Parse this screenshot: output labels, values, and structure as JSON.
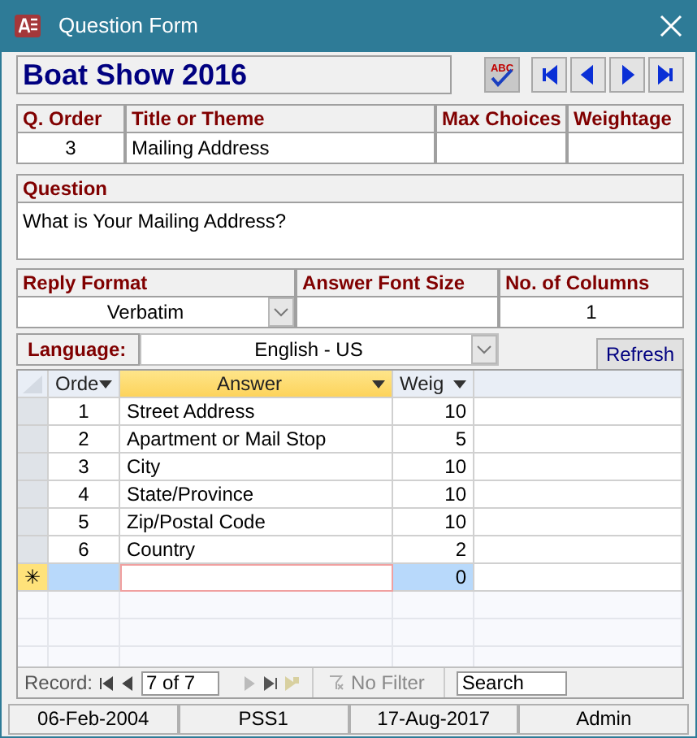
{
  "window": {
    "title": "Question Form"
  },
  "survey_title": "Boat Show 2016",
  "spell_check": {
    "label": "ABC"
  },
  "question_header": {
    "columns": [
      "Q. Order",
      "Title or Theme",
      "Max Choices",
      "Weightage"
    ],
    "q_order": "3",
    "title": "Mailing Address"
  },
  "question": {
    "label": "Question",
    "text": "What is Your Mailing Address?"
  },
  "reply": {
    "columns": [
      "Reply Format",
      "Answer Font Size",
      "No. of Columns"
    ],
    "reply_format": "Verbatim",
    "no_of_columns": "1"
  },
  "language": {
    "label": "Language:",
    "value": "English - US"
  },
  "refresh_button": "Refresh",
  "answers": {
    "columns": [
      {
        "label": "Orde",
        "selected": false
      },
      {
        "label": "Answer",
        "selected": true
      },
      {
        "label": "Weig",
        "selected": false
      }
    ],
    "rows": [
      {
        "order": "1",
        "answer": "Street Address",
        "weight": "10"
      },
      {
        "order": "2",
        "answer": "Apartment or Mail Stop",
        "weight": "5"
      },
      {
        "order": "3",
        "answer": "City",
        "weight": "10"
      },
      {
        "order": "4",
        "answer": "State/Province",
        "weight": "10"
      },
      {
        "order": "5",
        "answer": "Zip/Postal Code",
        "weight": "10"
      },
      {
        "order": "6",
        "answer": "Country",
        "weight": "2"
      }
    ],
    "new_row": {
      "marker": "✳",
      "weight": "0"
    }
  },
  "record_nav": {
    "label": "Record:",
    "position": "7 of 7",
    "filter": "No Filter",
    "search_placeholder": "Search"
  },
  "status_bar": [
    "06-Feb-2004",
    "PSS1",
    "17-Aug-2017",
    "Admin"
  ]
}
